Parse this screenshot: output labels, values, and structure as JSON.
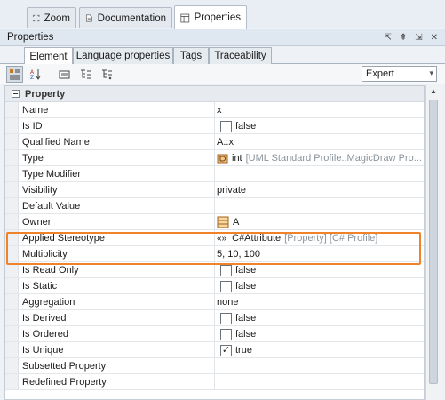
{
  "top_tabs": [
    {
      "label": "Zoom",
      "icon": "zoom-icon"
    },
    {
      "label": "Documentation",
      "icon": "document-icon"
    },
    {
      "label": "Properties",
      "icon": "properties-icon",
      "active": true
    }
  ],
  "panel": {
    "title": "Properties",
    "ctrl_float": "⇱",
    "ctrl_pin": "⇞",
    "ctrl_dock": "⇲",
    "ctrl_close": "✕"
  },
  "sub_tabs": [
    {
      "label": "Element",
      "active": true
    },
    {
      "label": "Language properties"
    },
    {
      "label": "Tags"
    },
    {
      "label": "Traceability"
    }
  ],
  "toolbar": {
    "mode": "Expert",
    "mode_arrow": "▾"
  },
  "section": {
    "label": "Property"
  },
  "rows": [
    {
      "name": "Name",
      "value": "x"
    },
    {
      "name": "Is ID",
      "value": "false",
      "checkbox": true,
      "checked": false
    },
    {
      "name": "Qualified Name",
      "value": "A::x"
    },
    {
      "name": "Type",
      "value": "int",
      "extra": "[UML Standard Profile::MagicDraw Pro...",
      "icon": "datatype-icon"
    },
    {
      "name": "Type Modifier",
      "value": ""
    },
    {
      "name": "Visibility",
      "value": "private"
    },
    {
      "name": "Default Value",
      "value": ""
    },
    {
      "name": "Owner",
      "value": "A",
      "icon": "class-icon"
    },
    {
      "name": "Applied Stereotype",
      "value": "C#Attribute",
      "extra": "[Property] [C# Profile]",
      "icon": "stereotype-icon",
      "icon_text": "«»"
    },
    {
      "name": "Multiplicity",
      "value": "5, 10, 100"
    },
    {
      "name": "Is Read Only",
      "value": "false",
      "checkbox": true,
      "checked": false
    },
    {
      "name": "Is Static",
      "value": "false",
      "checkbox": true,
      "checked": false
    },
    {
      "name": "Aggregation",
      "value": "none"
    },
    {
      "name": "Is Derived",
      "value": "false",
      "checkbox": true,
      "checked": false
    },
    {
      "name": "Is Ordered",
      "value": "false",
      "checkbox": true,
      "checked": false
    },
    {
      "name": "Is Unique",
      "value": "true",
      "checkbox": true,
      "checked": true,
      "check_mark": "✓"
    },
    {
      "name": "Subsetted Property",
      "value": ""
    },
    {
      "name": "Redefined Property",
      "value": ""
    }
  ],
  "colors": {
    "highlight": "#f0832a",
    "accent": "#dfe7f1"
  }
}
